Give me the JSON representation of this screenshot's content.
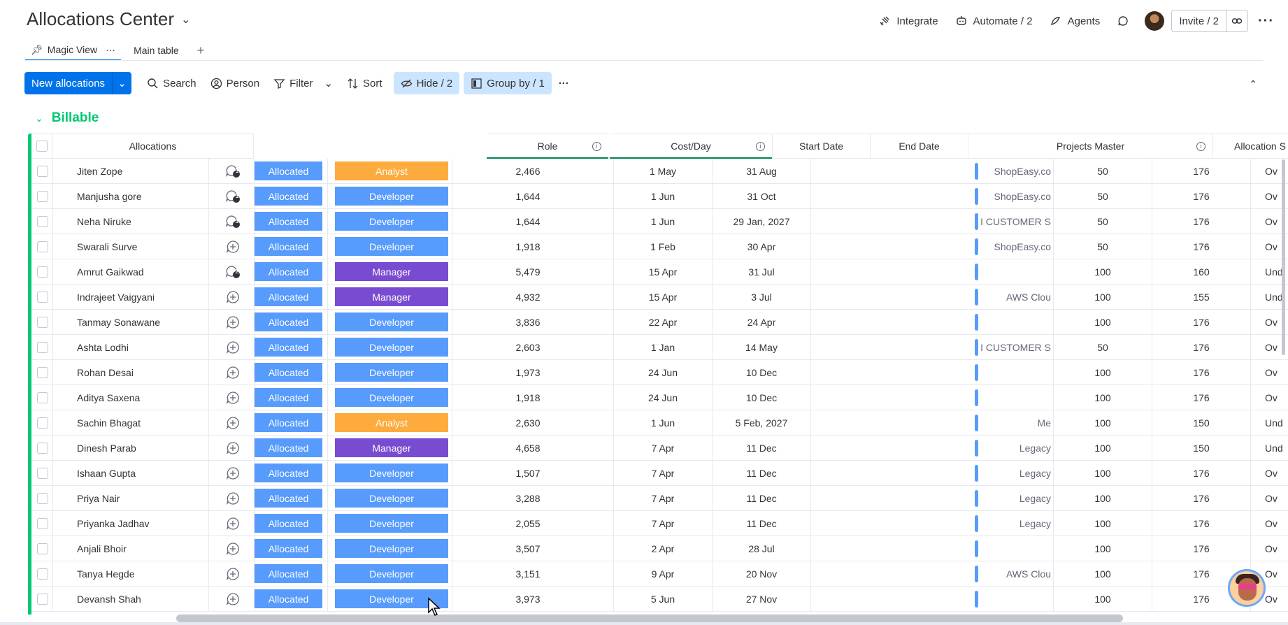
{
  "app": {
    "title": "Allocations Center",
    "top_actions": {
      "integrate": "Integrate",
      "automate": "Automate / 2",
      "agents": "Agents",
      "invite": "Invite / 2"
    }
  },
  "tabs": [
    {
      "label": "Magic View"
    },
    {
      "label": "Main table"
    }
  ],
  "toolbar": {
    "new_label": "New allocations",
    "search": "Search",
    "person": "Person",
    "filter": "Filter",
    "sort": "Sort",
    "hide": "Hide / 2",
    "group_by": "Group by / 1"
  },
  "group": {
    "title": "Billable",
    "color": "#00c875"
  },
  "columns": {
    "allocations": "Allocations",
    "role": "Role",
    "cost_day": "Cost/Day",
    "start_date": "Start Date",
    "end_date": "End Date",
    "projects_master": "Projects Master",
    "allocation": "Allocation S"
  },
  "status_colors": {
    "Allocated": "#579bfc",
    "Analyst": "#fdab3d",
    "Developer": "#579bfc",
    "Manager": "#784bd1"
  },
  "rows": [
    {
      "name": "Jiten Zope",
      "updates": "1",
      "status": "Allocated",
      "role": "Analyst",
      "cost": "2,466",
      "start": "1 May",
      "end": "31 Aug",
      "project": "ShopEasy.co",
      "pct": "50",
      "hours": "176",
      "alloc": "Ov"
    },
    {
      "name": "Manjusha gore",
      "updates": "1",
      "status": "Allocated",
      "role": "Developer",
      "cost": "1,644",
      "start": "1 Jun",
      "end": "31 Oct",
      "project": "ShopEasy.co",
      "pct": "50",
      "hours": "176",
      "alloc": "Ov"
    },
    {
      "name": "Neha Niruke",
      "updates": "1",
      "status": "Allocated",
      "role": "Developer",
      "cost": "1,644",
      "start": "1 Jun",
      "end": "29 Jan, 2027",
      "project": "AI CUSTOMER S",
      "pct": "50",
      "hours": "176",
      "alloc": "Ov"
    },
    {
      "name": "Swarali Surve",
      "updates": "",
      "status": "Allocated",
      "role": "Developer",
      "cost": "1,918",
      "start": "1 Feb",
      "end": "30 Apr",
      "project": "ShopEasy.co",
      "pct": "50",
      "hours": "176",
      "alloc": "Ov"
    },
    {
      "name": "Amrut Gaikwad",
      "updates": "2",
      "status": "Allocated",
      "role": "Manager",
      "cost": "5,479",
      "start": "15 Apr",
      "end": "31 Jul",
      "project": "",
      "pct": "100",
      "hours": "160",
      "alloc": "Und"
    },
    {
      "name": "Indrajeet Vaigyani",
      "updates": "",
      "status": "Allocated",
      "role": "Manager",
      "cost": "4,932",
      "start": "15 Apr",
      "end": "3 Jul",
      "project": "AWS Clou",
      "pct": "100",
      "hours": "155",
      "alloc": "Und"
    },
    {
      "name": "Tanmay Sonawane",
      "updates": "",
      "status": "Allocated",
      "role": "Developer",
      "cost": "3,836",
      "start": "22 Apr",
      "end": "24 Apr",
      "project": "",
      "pct": "100",
      "hours": "176",
      "alloc": "Ov"
    },
    {
      "name": "Ashta Lodhi",
      "updates": "",
      "status": "Allocated",
      "role": "Developer",
      "cost": "2,603",
      "start": "1 Jan",
      "end": "14 May",
      "project": "AI CUSTOMER S",
      "pct": "50",
      "hours": "176",
      "alloc": "Ov"
    },
    {
      "name": "Rohan Desai",
      "updates": "",
      "status": "Allocated",
      "role": "Developer",
      "cost": "1,973",
      "start": "24 Jun",
      "end": "10 Dec",
      "project": "",
      "pct": "100",
      "hours": "176",
      "alloc": "Ov"
    },
    {
      "name": "Aditya Saxena",
      "updates": "",
      "status": "Allocated",
      "role": "Developer",
      "cost": "1,918",
      "start": "24 Jun",
      "end": "10 Dec",
      "project": "",
      "pct": "100",
      "hours": "176",
      "alloc": "Ov"
    },
    {
      "name": "Sachin Bhagat",
      "updates": "",
      "status": "Allocated",
      "role": "Analyst",
      "cost": "2,630",
      "start": "1 Jun",
      "end": "5 Feb, 2027",
      "project": "Me",
      "pct": "100",
      "hours": "150",
      "alloc": "Und"
    },
    {
      "name": "Dinesh Parab",
      "updates": "",
      "status": "Allocated",
      "role": "Manager",
      "cost": "4,658",
      "start": "7 Apr",
      "end": "11 Dec",
      "project": "Legacy",
      "pct": "100",
      "hours": "150",
      "alloc": "Und"
    },
    {
      "name": "Ishaan Gupta",
      "updates": "",
      "status": "Allocated",
      "role": "Developer",
      "cost": "1,507",
      "start": "7 Apr",
      "end": "11 Dec",
      "project": "Legacy",
      "pct": "100",
      "hours": "176",
      "alloc": "Ov"
    },
    {
      "name": "Priya Nair",
      "updates": "",
      "status": "Allocated",
      "role": "Developer",
      "cost": "3,288",
      "start": "7 Apr",
      "end": "11 Dec",
      "project": "Legacy",
      "pct": "100",
      "hours": "176",
      "alloc": "Ov"
    },
    {
      "name": "Priyanka Jadhav",
      "updates": "",
      "status": "Allocated",
      "role": "Developer",
      "cost": "2,055",
      "start": "7 Apr",
      "end": "11 Dec",
      "project": "Legacy",
      "pct": "100",
      "hours": "176",
      "alloc": "Ov"
    },
    {
      "name": "Anjali Bhoir",
      "updates": "",
      "status": "Allocated",
      "role": "Developer",
      "cost": "3,507",
      "start": "2 Apr",
      "end": "28 Jul",
      "project": "",
      "pct": "100",
      "hours": "176",
      "alloc": "Ov"
    },
    {
      "name": "Tanya Hegde",
      "updates": "",
      "status": "Allocated",
      "role": "Developer",
      "cost": "3,151",
      "start": "9 Apr",
      "end": "20 Nov",
      "project": "AWS Clou",
      "pct": "100",
      "hours": "176",
      "alloc": "Ov"
    },
    {
      "name": "Devansh Shah",
      "updates": "",
      "status": "Allocated",
      "role": "Developer",
      "cost": "3,973",
      "start": "5 Jun",
      "end": "27 Nov",
      "project": "",
      "pct": "100",
      "hours": "176",
      "alloc": "Ov"
    }
  ]
}
